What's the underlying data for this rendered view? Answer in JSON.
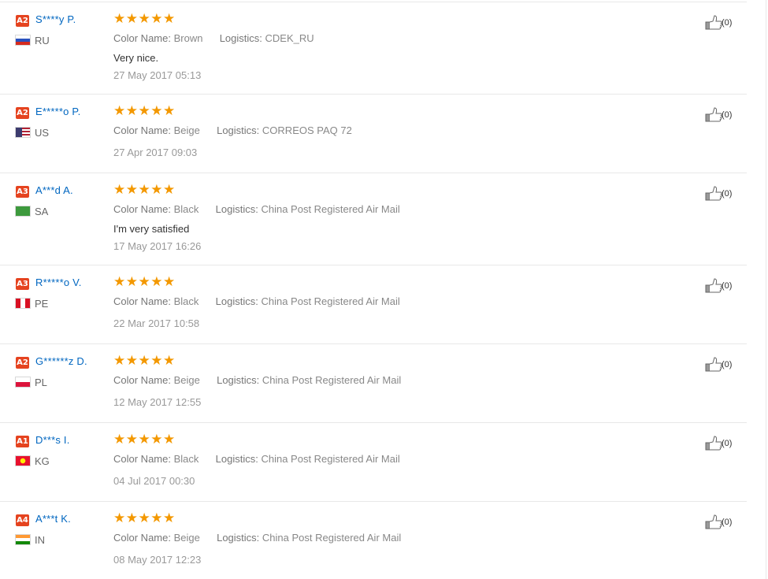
{
  "labels": {
    "color": "Color Name:",
    "logistics": "Logistics:"
  },
  "feedback": [
    {
      "badge": "A2",
      "user": "S****y P.",
      "country": "RU",
      "stars": "★★★★★",
      "color": "Brown",
      "logistics": "CDEK_RU",
      "text": "Very nice.",
      "date": "27 May 2017 05:13",
      "helpful": "(0)"
    },
    {
      "badge": "A2",
      "user": "E*****o P.",
      "country": "US",
      "stars": "★★★★★",
      "color": "Beige",
      "logistics": "CORREOS PAQ 72",
      "text": "",
      "date": "27 Apr 2017 09:03",
      "helpful": "(0)"
    },
    {
      "badge": "A3",
      "user": "A***d A.",
      "country": "SA",
      "stars": "★★★★★",
      "color": "Black",
      "logistics": "China Post Registered Air Mail",
      "text": "I'm very satisfied",
      "date": "17 May 2017 16:26",
      "helpful": "(0)"
    },
    {
      "badge": "A3",
      "user": "R*****o V.",
      "country": "PE",
      "stars": "★★★★★",
      "color": "Black",
      "logistics": "China Post Registered Air Mail",
      "text": "",
      "date": "22 Mar 2017 10:58",
      "helpful": "(0)"
    },
    {
      "badge": "A2",
      "user": "G******z D.",
      "country": "PL",
      "stars": "★★★★★",
      "color": "Beige",
      "logistics": "China Post Registered Air Mail",
      "text": "",
      "date": "12 May 2017 12:55",
      "helpful": "(0)"
    },
    {
      "badge": "A1",
      "user": "D***s I.",
      "country": "KG",
      "stars": "★★★★★",
      "color": "Black",
      "logistics": "China Post Registered Air Mail",
      "text": "",
      "date": "04 Jul 2017 00:30",
      "helpful": "(0)"
    },
    {
      "badge": "A4",
      "user": "A***t K.",
      "country": "IN",
      "stars": "★★★★★",
      "color": "Beige",
      "logistics": "China Post Registered Air Mail",
      "text": "",
      "date": "08 May 2017 12:23",
      "helpful": "(0)"
    }
  ]
}
